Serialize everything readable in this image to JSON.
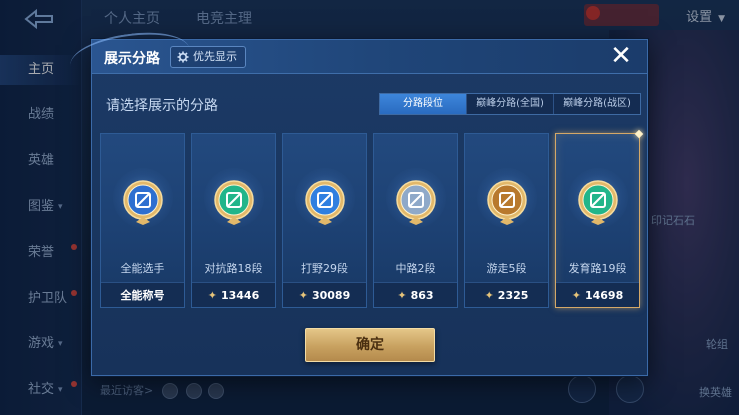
{
  "background": {
    "nav": [
      {
        "label": "主页",
        "active": true
      },
      {
        "label": "战绩"
      },
      {
        "label": "英雄"
      },
      {
        "label": "图鉴",
        "caret": "▾"
      },
      {
        "label": "荣誉",
        "dot": true
      },
      {
        "label": "护卫队",
        "dot": true
      },
      {
        "label": "游戏",
        "caret": "▾"
      },
      {
        "label": "社交",
        "caret": "▾",
        "dot": true
      }
    ],
    "top_tabs": [
      "个人主页",
      "电竞主理"
    ],
    "settings_label": "设置",
    "bottom_text": "最近访客>",
    "right_labels": [
      "印记石石",
      "轮组",
      "换英雄"
    ]
  },
  "modal": {
    "title": "展示分路",
    "priority_label": "优先显示",
    "close_symbol": "✕",
    "subtitle": "请选择展示的分路",
    "tabs": [
      {
        "label": "分路段位",
        "active": true
      },
      {
        "label": "巅峰分路(全国)"
      },
      {
        "label": "巅峰分路(战区)"
      }
    ],
    "cards": [
      {
        "role": "全能选手",
        "foot": "全能称号",
        "icon": "all-round-badge-icon",
        "has_star": false,
        "color": "#2e6fd0"
      },
      {
        "role": "对抗路18段",
        "foot": "13446",
        "icon": "clash-lane-badge-icon",
        "has_star": true,
        "color": "#22b58a"
      },
      {
        "role": "打野29段",
        "foot": "30089",
        "icon": "jungle-badge-icon",
        "has_star": true,
        "color": "#2f7fe0"
      },
      {
        "role": "中路2段",
        "foot": "863",
        "icon": "mid-lane-badge-icon",
        "has_star": true,
        "color": "#8fa9c9"
      },
      {
        "role": "游走5段",
        "foot": "2325",
        "icon": "roam-badge-icon",
        "has_star": true,
        "color": "#b8792d"
      },
      {
        "role": "发育路19段",
        "foot": "14698",
        "icon": "farm-lane-badge-icon",
        "has_star": true,
        "color": "#22b58a",
        "selected": true
      }
    ],
    "confirm_label": "确定"
  }
}
